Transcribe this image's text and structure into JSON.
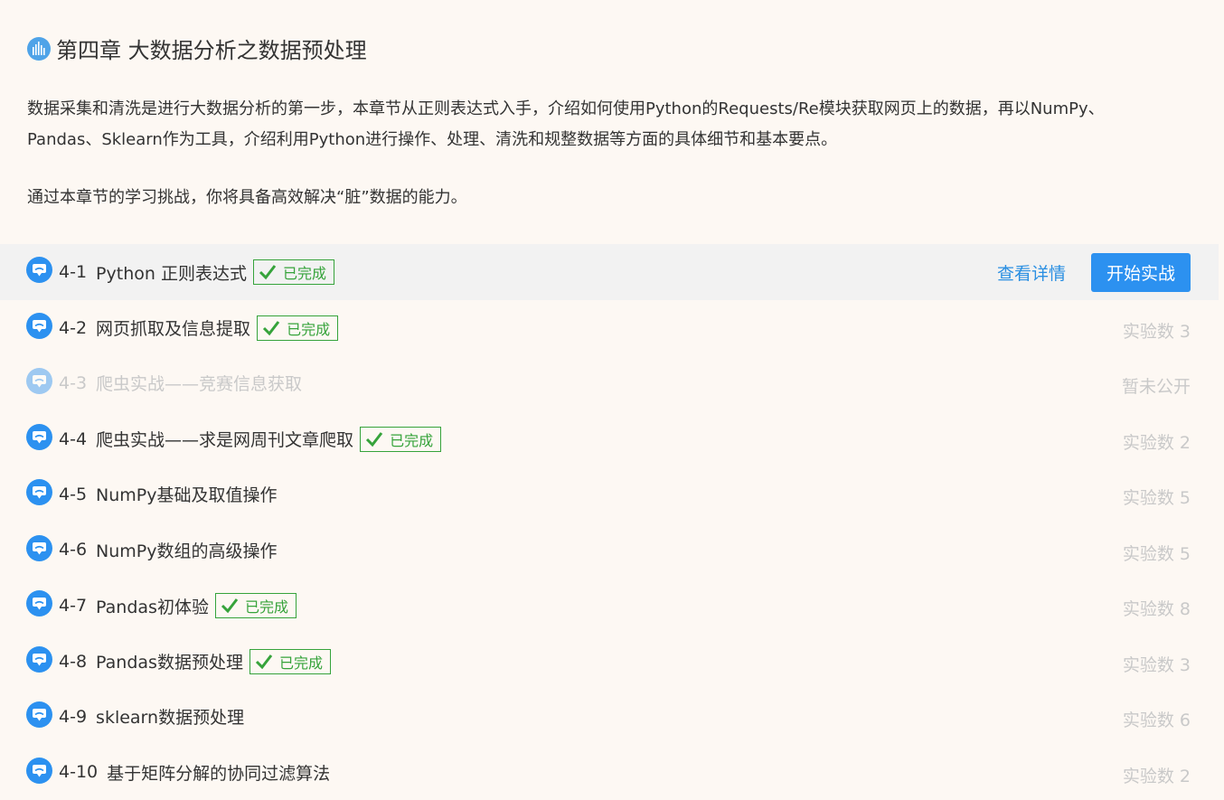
{
  "chapter": {
    "title": "第四章 大数据分析之数据预处理",
    "desc1": "数据采集和清洗是进行大数据分析的第一步，本章节从正则表达式入手，介绍如何使用Python的Requests/Re模块获取网页上的数据，再以NumPy、Pandas、Sklearn作为工具，介绍利用Python进行操作、处理、清洗和规整数据等方面的具体细节和基本要点。",
    "desc2": "通过本章节的学习挑战，你将具备高效解决“脏”数据的能力。"
  },
  "badge_label": "已完成",
  "actions": {
    "view": "查看详情",
    "start": "开始实战"
  },
  "colors": {
    "accent": "#2c91f0",
    "done": "#36a33b",
    "muted": "#c9c9c9",
    "background": "#fdf8f3"
  },
  "icons": {
    "chapter": "bar-chart-circle-icon",
    "lesson": "chat-bubble-icon",
    "done": "checkmark-icon"
  },
  "lessons": [
    {
      "num": "4-1",
      "title": "Python 正则表达式",
      "done": true,
      "meta": ""
    },
    {
      "num": "4-2",
      "title": "网页抓取及信息提取",
      "done": true,
      "meta": "实验数 3"
    },
    {
      "num": "4-3",
      "title": "爬虫实战——竞赛信息获取",
      "done": false,
      "meta": "暂未公开"
    },
    {
      "num": "4-4",
      "title": "爬虫实战——求是网周刊文章爬取",
      "done": true,
      "meta": "实验数 2"
    },
    {
      "num": "4-5",
      "title": "NumPy基础及取值操作",
      "done": false,
      "meta": "实验数 5"
    },
    {
      "num": "4-6",
      "title": "NumPy数组的高级操作",
      "done": false,
      "meta": "实验数 5"
    },
    {
      "num": "4-7",
      "title": "Pandas初体验",
      "done": true,
      "meta": "实验数 8"
    },
    {
      "num": "4-8",
      "title": "Pandas数据预处理",
      "done": true,
      "meta": "实验数 3"
    },
    {
      "num": "4-9",
      "title": "sklearn数据预处理",
      "done": false,
      "meta": "实验数 6"
    },
    {
      "num": "4-10",
      "title": "基于矩阵分解的协同过滤算法",
      "done": false,
      "meta": "实验数 2"
    }
  ]
}
